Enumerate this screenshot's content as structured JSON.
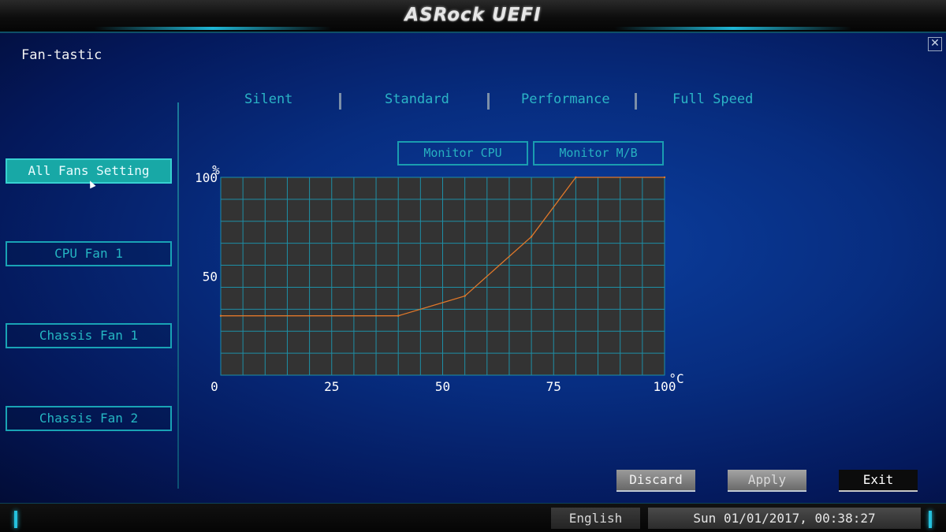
{
  "header": {
    "logo_text": "ASRock UEFI"
  },
  "page": {
    "title": "Fan-tastic",
    "close_icon": "close-icon"
  },
  "sidebar": {
    "items": [
      {
        "label": "All Fans Setting",
        "active": true
      },
      {
        "label": "CPU Fan 1",
        "active": false
      },
      {
        "label": "Chassis Fan 1",
        "active": false
      },
      {
        "label": "Chassis Fan 2",
        "active": false
      }
    ]
  },
  "presets": [
    "Silent",
    "Standard",
    "Performance",
    "Full Speed"
  ],
  "monitor": {
    "cpu_label": "Monitor CPU",
    "mb_label": "Monitor M/B"
  },
  "chart_data": {
    "type": "line",
    "title": "",
    "xlabel": "°C",
    "ylabel": "%",
    "xlim": [
      0,
      100
    ],
    "ylim": [
      0,
      100
    ],
    "x_ticks": [
      0,
      25,
      50,
      75,
      100
    ],
    "y_ticks": [
      50,
      100
    ],
    "grid": true,
    "series": [
      {
        "x": [
          0,
          40,
          55,
          70,
          80,
          100
        ],
        "y": [
          30,
          30,
          40,
          70,
          100,
          100
        ]
      }
    ],
    "colors": {
      "line": "#e0782a",
      "grid": "#1e8fa6",
      "background": "#333333"
    }
  },
  "actions": {
    "discard": "Discard",
    "apply": "Apply",
    "exit": "Exit"
  },
  "footer": {
    "language": "English",
    "datetime": "Sun 01/01/2017, 00:38:27"
  }
}
